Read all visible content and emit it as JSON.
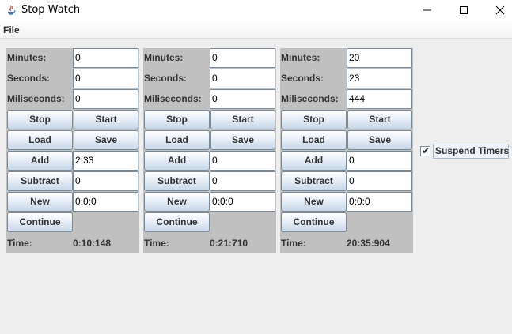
{
  "window": {
    "title": "Stop Watch",
    "controls": {
      "minimize": "minimize-icon",
      "maximize": "maximize-icon",
      "close": "close-icon"
    }
  },
  "menu": {
    "file": "File"
  },
  "labels": {
    "minutes": "Minutes:",
    "seconds": "Seconds:",
    "miliseconds": "Miliseconds:",
    "stop": "Stop",
    "start": "Start",
    "load": "Load",
    "save": "Save",
    "add": "Add",
    "subtract": "Subtract",
    "new": "New",
    "continue": "Continue",
    "time": "Time:"
  },
  "timers": [
    {
      "minutes": "0",
      "seconds": "0",
      "miliseconds": "0",
      "add": "2:33",
      "subtract": "0",
      "new": "0:0:0",
      "time": "0:10:148"
    },
    {
      "minutes": "0",
      "seconds": "0",
      "miliseconds": "0",
      "add": "0",
      "subtract": "0",
      "new": "0:0:0",
      "time": "0:21:710"
    },
    {
      "minutes": "20",
      "seconds": "23",
      "miliseconds": "444",
      "add": "0",
      "subtract": "0",
      "new": "0:0:0",
      "time": "20:35:904"
    }
  ],
  "suspend": {
    "label": "Suspend Timers",
    "checked": true,
    "mark": "✔"
  }
}
